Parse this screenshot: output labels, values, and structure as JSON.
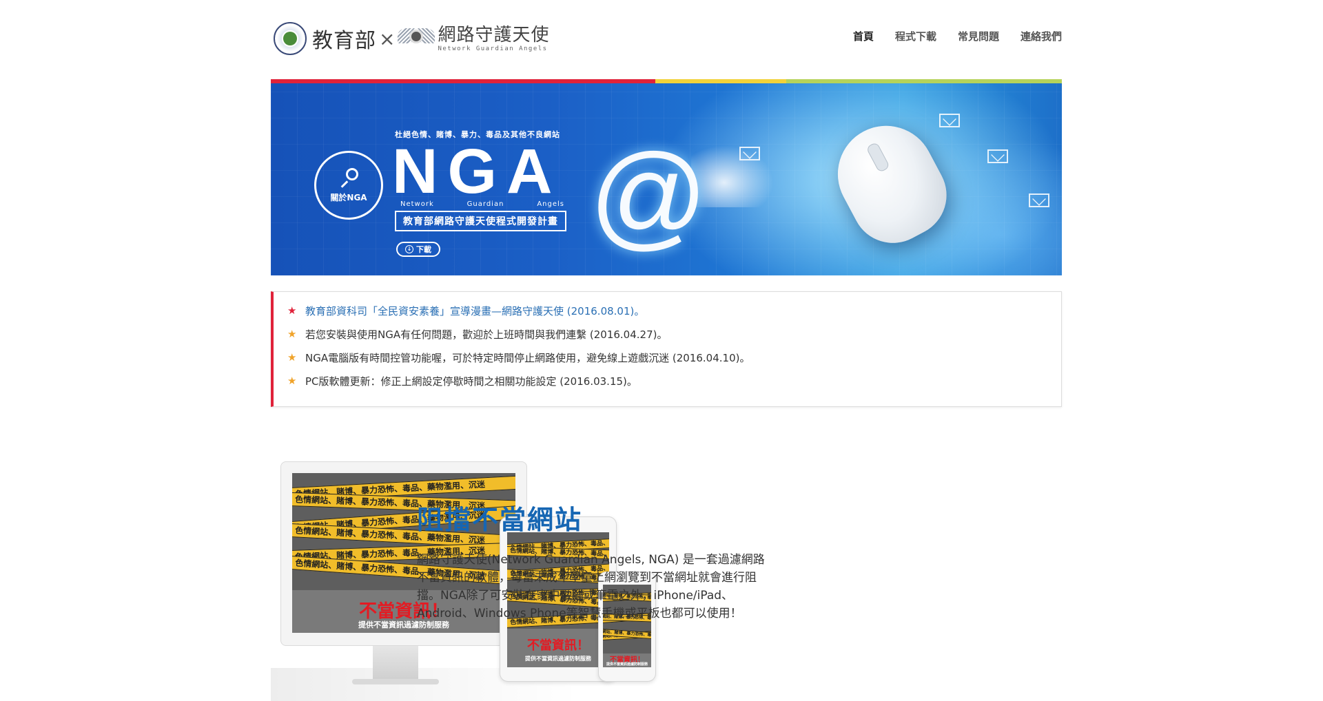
{
  "header": {
    "logo_moe": "教育部",
    "logo_times": "×",
    "logo_nga_cn": "網路守護天使",
    "logo_nga_en": "Network Guardian Angels",
    "nav": [
      {
        "label": "首頁",
        "active": true
      },
      {
        "label": "程式下載",
        "active": false
      },
      {
        "label": "常見問題",
        "active": false
      },
      {
        "label": "連絡我們",
        "active": false
      }
    ]
  },
  "stripe_colors": [
    "#e0223a",
    "#f2d23a",
    "#b6d35a"
  ],
  "banner": {
    "tagline": "杜絕色情、賭博、暴力、毒品及其他不良網站",
    "about_label": "關於NGA",
    "nga_title": "NGA",
    "nga_sub": [
      "Network",
      "Guardian",
      "Angels"
    ],
    "plan_label": "教育部網路守護天使程式開發計畫",
    "download_label": "下載",
    "at_symbol": "@"
  },
  "news": [
    {
      "text": "教育部資科司「全民資安素養」宣導漫畫—網路守護天使 (2016.08.01)。",
      "star": "red",
      "is_link": true
    },
    {
      "text": "若您安裝與使用NGA有任何問題，歡迎於上班時間與我們連繫 (2016.04.27)。",
      "star": "orange",
      "is_link": false
    },
    {
      "text": "NGA電腦版有時間控管功能喔，可於特定時間停止網路使用，避免線上遊戲沉迷 (2016.04.10)。",
      "star": "orange",
      "is_link": false
    },
    {
      "text": "PC版軟體更新：修正上網設定停歇時間之相關功能設定 (2016.03.15)。",
      "star": "orange",
      "is_link": false
    }
  ],
  "devices": {
    "tape_text": "色情網站、賭博、暴力恐怖、毒品、藥物濫用、沉迷",
    "warning_title": "不當資訊！",
    "warning_sub": "提供不當資訊過濾防制服務"
  },
  "feature": {
    "title": "阻擋不當網站",
    "body": "網路守護天使(Network Guardian Angels, NGA) 是一套過濾網路不當資訊的軟體，每當未成年學童上網瀏覽到不當網址就會進行阻擋。NGA除了可安裝在家中電腦或筆電之外，iPhone/iPad、Android、Windows Phone等智慧手機或平板也都可以使用！"
  }
}
